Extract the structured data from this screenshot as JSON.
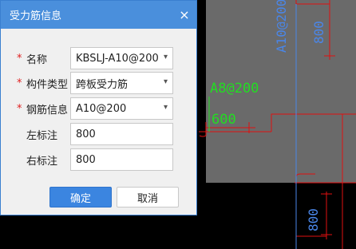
{
  "dialog": {
    "title": "受力筋信息",
    "close_glyph": "×",
    "fields": {
      "name": {
        "label": "名称",
        "value": "KBSLJ-A10@200",
        "required": true
      },
      "component_type": {
        "label": "构件类型",
        "value": "跨板受力筋",
        "required": true
      },
      "rebar_info": {
        "label": "钢筋信息",
        "value": "A10@200",
        "required": true
      },
      "left_mark": {
        "label": "左标注",
        "value": "800",
        "required": false
      },
      "right_mark": {
        "label": "右标注",
        "value": "800",
        "required": false
      }
    },
    "ok_label": "确定",
    "cancel_label": "取消",
    "required_marker": "*"
  },
  "cad": {
    "labels": {
      "rebar_green": "A8@200",
      "dim_green": "600",
      "rebar_blue": "A10@200",
      "dim_blue_top": "800",
      "dim_blue_bottom": "800"
    },
    "colors": {
      "green": "#22dd22",
      "blue": "#4a86e8",
      "red": "#e01010",
      "gray": "#6a6a6a"
    }
  }
}
